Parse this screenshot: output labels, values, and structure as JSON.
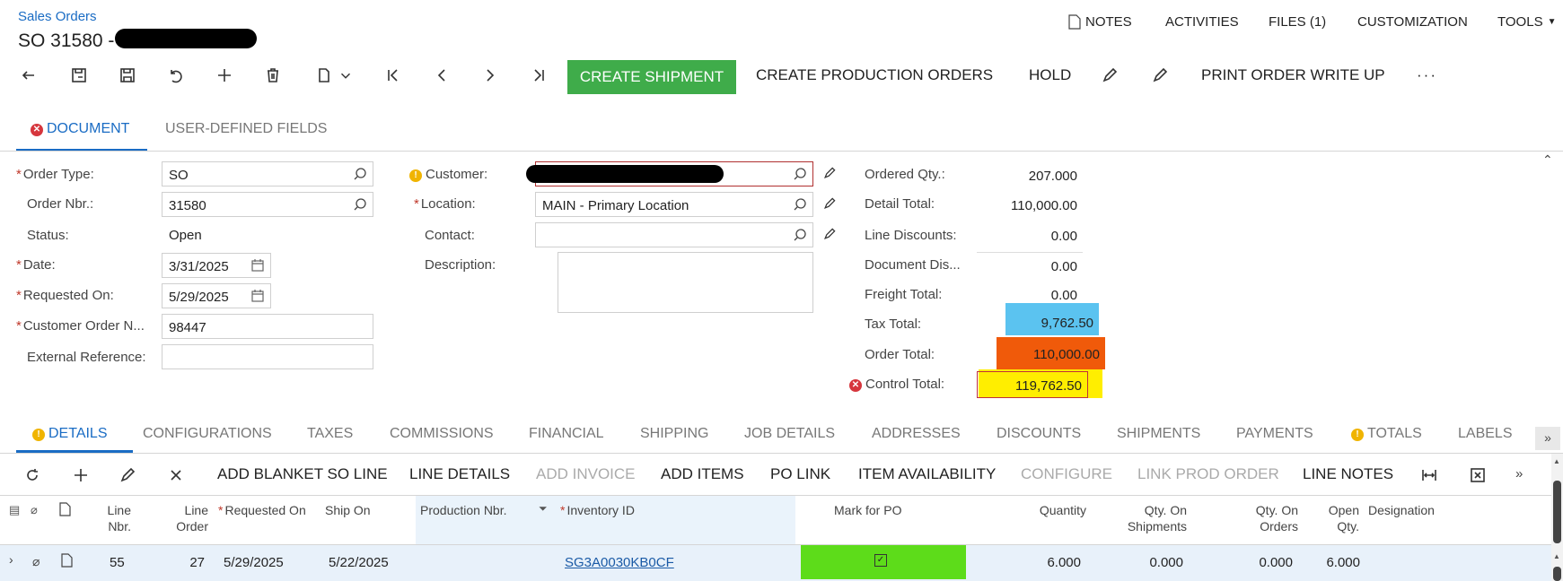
{
  "breadcrumb": "Sales Orders",
  "page_title": "SO 31580 -",
  "top_nav": {
    "notes": "NOTES",
    "activities": "ACTIVITIES",
    "files": "FILES (1)",
    "customization": "CUSTOMIZATION",
    "tools": "TOOLS"
  },
  "toolbar": {
    "create_shipment": "CREATE SHIPMENT",
    "create_production_orders": "CREATE PRODUCTION ORDERS",
    "hold": "HOLD",
    "print_order": "PRINT ORDER WRITE UP",
    "more": "···"
  },
  "tabs": {
    "document": "DOCUMENT",
    "user_defined": "USER-DEFINED FIELDS"
  },
  "form": {
    "order_type_label": "Order Type:",
    "order_type": "SO",
    "order_nbr_label": "Order Nbr.:",
    "order_nbr": "31580",
    "status_label": "Status:",
    "status": "Open",
    "date_label": "Date:",
    "date": "3/31/2025",
    "requested_on_label": "Requested On:",
    "requested_on": "5/29/2025",
    "customer_order_label": "Customer Order N...",
    "customer_order": "98447",
    "external_ref_label": "External Reference:",
    "external_ref": "",
    "customer_label": "Customer:",
    "customer": "",
    "location_label": "Location:",
    "location": "MAIN - Primary Location",
    "contact_label": "Contact:",
    "contact": "",
    "description_label": "Description:",
    "description": ""
  },
  "totals": {
    "ordered_qty_label": "Ordered Qty.:",
    "ordered_qty": "207.000",
    "detail_total_label": "Detail Total:",
    "detail_total": "110,000.00",
    "line_discounts_label": "Line Discounts:",
    "line_discounts": "0.00",
    "document_dis_label": "Document Dis...",
    "document_dis": "0.00",
    "freight_total_label": "Freight Total:",
    "freight_total": "0.00",
    "tax_total_label": "Tax Total:",
    "tax_total": "9,762.50",
    "order_total_label": "Order Total:",
    "order_total": "110,000.00",
    "control_total_label": "Control Total:",
    "control_total": "119,762.50"
  },
  "detail_tabs": [
    "DETAILS",
    "CONFIGURATIONS",
    "TAXES",
    "COMMISSIONS",
    "FINANCIAL",
    "SHIPPING",
    "JOB DETAILS",
    "ADDRESSES",
    "DISCOUNTS",
    "SHIPMENTS",
    "PAYMENTS",
    "TOTALS",
    "LABELS"
  ],
  "grid_toolbar": {
    "add_blanket": "ADD BLANKET SO LINE",
    "line_details": "LINE DETAILS",
    "add_invoice": "ADD INVOICE",
    "add_items": "ADD ITEMS",
    "po_link": "PO LINK",
    "item_availability": "ITEM AVAILABILITY",
    "configure": "CONFIGURE",
    "link_prod_order": "LINK PROD ORDER",
    "line_notes": "LINE NOTES"
  },
  "grid_headers": {
    "line_nbr": "Line Nbr.",
    "line_order": "Line Order",
    "requested_on": "Requested On",
    "ship_on": "Ship On",
    "production_nbr": "Production Nbr.",
    "inventory_id": "Inventory ID",
    "mark_for_po": "Mark for PO",
    "quantity": "Quantity",
    "qty_on_shipments": "Qty. On Shipments",
    "qty_on_orders": "Qty. On Orders",
    "open_qty": "Open Qty.",
    "designation": "Designation"
  },
  "grid_row": {
    "line_nbr": "55",
    "line_order": "27",
    "requested_on": "5/29/2025",
    "ship_on": "5/22/2025",
    "inventory_id": "SG3A0030KB0CF",
    "quantity": "6.000",
    "qty_on_shipments": "0.000",
    "qty_on_orders": "0.000",
    "open_qty": "6.000"
  },
  "colors": {
    "accent": "#1a6cc4",
    "green": "#3fac4a",
    "tax": "#5bc3f0",
    "order_total": "#f05a0a",
    "control_total": "#ffee00",
    "mark_po": "#5ddc1a"
  }
}
